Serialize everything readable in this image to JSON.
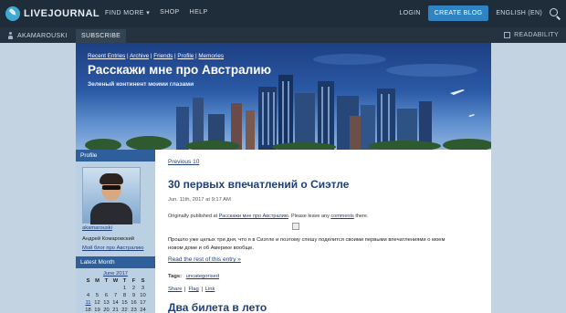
{
  "topbar": {
    "logo_text": "LIVEJOURNAL",
    "nav": [
      "FIND MORE",
      "SHOP",
      "HELP"
    ],
    "login": "LOGIN",
    "create_blog": "CREATE BLOG",
    "language": "ENGLISH (EN)"
  },
  "subbar": {
    "username": "AKAMAROUSKI",
    "subscribe": "SUBSCRIBE",
    "readability": "READABILITY"
  },
  "header": {
    "links": [
      "Recent Entries",
      "Archive",
      "Friends",
      "Profile",
      "Memories"
    ],
    "title": "Расскажи мне про Австралию",
    "subtitle": "Зеленый континент моими глазами"
  },
  "sidebar": {
    "profile_heading": "Profile",
    "username": "akamarouski",
    "full_name": "Андрей Комаровский",
    "blog_link": "Мой блог про Австралию",
    "latest_month_heading": "Latest Month",
    "calendar": {
      "month": "June 2017",
      "days": [
        "S",
        "M",
        "T",
        "W",
        "T",
        "F",
        "S"
      ],
      "weeks": [
        [
          "",
          "",
          "",
          "",
          "1",
          "2",
          "3"
        ],
        [
          "4",
          "5",
          "6",
          "7",
          "8",
          "9",
          "10"
        ],
        [
          "11",
          "12",
          "13",
          "14",
          "15",
          "16",
          "17"
        ],
        [
          "18",
          "19",
          "20",
          "21",
          "22",
          "23",
          "24"
        ]
      ],
      "linked_day": "11"
    }
  },
  "content": {
    "previous": "Previous 10",
    "post": {
      "title": "30 первых впечатлений о Сиэтле",
      "date": "Jun. 11th, 2017 at 9:17 AM",
      "orig_prefix": "Originally published at",
      "orig_link": "Расскажи мне про Австралию",
      "orig_mid": ". Please leave any",
      "orig_comments": "comments",
      "orig_suffix": "there.",
      "body": "Прошло уже целых три дня, что я в Сиэтле и поэтому спешу поделится своими первыми впечатлениями о моем новом доме и об Америке вообще.",
      "read_more": "Read the rest of this entry »",
      "tags_label": "Tags:",
      "tag": "uncategorised",
      "actions": [
        "Share",
        "Flag",
        "Link"
      ]
    },
    "next_post_title": "Два билета в лето"
  },
  "colors": {
    "topbar_bg": "#1f2d3a",
    "accent_button": "#2f83c0",
    "link": "#1f3f7a",
    "sidebar_heading": "#2f5f9a"
  }
}
